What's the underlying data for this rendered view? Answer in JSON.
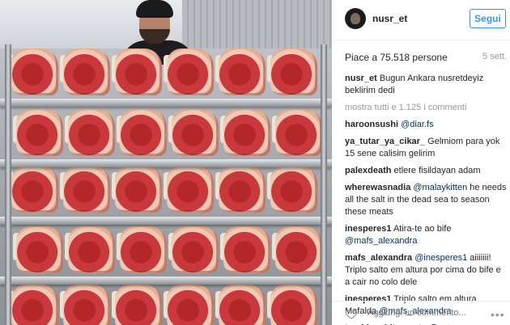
{
  "header": {
    "username": "nusr_et",
    "follow_label": "Segui"
  },
  "post": {
    "likes": "Piace a 75.518 persone",
    "age": "5 sett.",
    "caption_user": "nusr_et",
    "caption_text": "Bugun Ankara nusretdeyiz beklirim dedi",
    "show_all": "mostra tutti e 1.125 i commenti"
  },
  "comments": [
    {
      "user": "haroonsushi",
      "parts": [
        {
          "type": "mention",
          "text": "@diar.fs"
        }
      ]
    },
    {
      "user": "ya_tutar_ya_cikar_",
      "parts": [
        {
          "type": "text",
          "text": "Gelmiom para yok 15 sene calisim gelirim"
        }
      ]
    },
    {
      "user": "palexdeath",
      "parts": [
        {
          "type": "text",
          "text": "etlere fisildayan adam"
        }
      ]
    },
    {
      "user": "wherewasnadia",
      "parts": [
        {
          "type": "mention",
          "text": "@malaykitten"
        },
        {
          "type": "text",
          "text": " he needs all the salt in the dead sea to season these meats"
        }
      ]
    },
    {
      "user": "inesperes1",
      "parts": [
        {
          "type": "text",
          "text": "Atira-te ao bife "
        },
        {
          "type": "mention",
          "text": "@mafs_alexandra"
        }
      ]
    },
    {
      "user": "mafs_alexandra",
      "parts": [
        {
          "type": "mention",
          "text": "@inesperes1"
        },
        {
          "type": "text",
          "text": " aiiiiiii! Triplo salto em altura por cima do bife e a cair no colo dele"
        }
      ]
    },
    {
      "user": "inesperes1",
      "parts": [
        {
          "type": "text",
          "text": "Triplo salto em altura Mafalda "
        },
        {
          "type": "mention",
          "text": "@mafs_alexandra"
        }
      ]
    },
    {
      "user": "tumblr._shit_.posts",
      "parts": [
        {
          "type": "mention",
          "text": "@peta"
        }
      ]
    }
  ],
  "footer": {
    "comment_placeholder": "Aggiungi un commento...",
    "more_icon": "more-options-icon"
  },
  "colors": {
    "follow_blue": "#3897f0",
    "mention_blue": "#003569",
    "muted_gray": "#999999"
  }
}
